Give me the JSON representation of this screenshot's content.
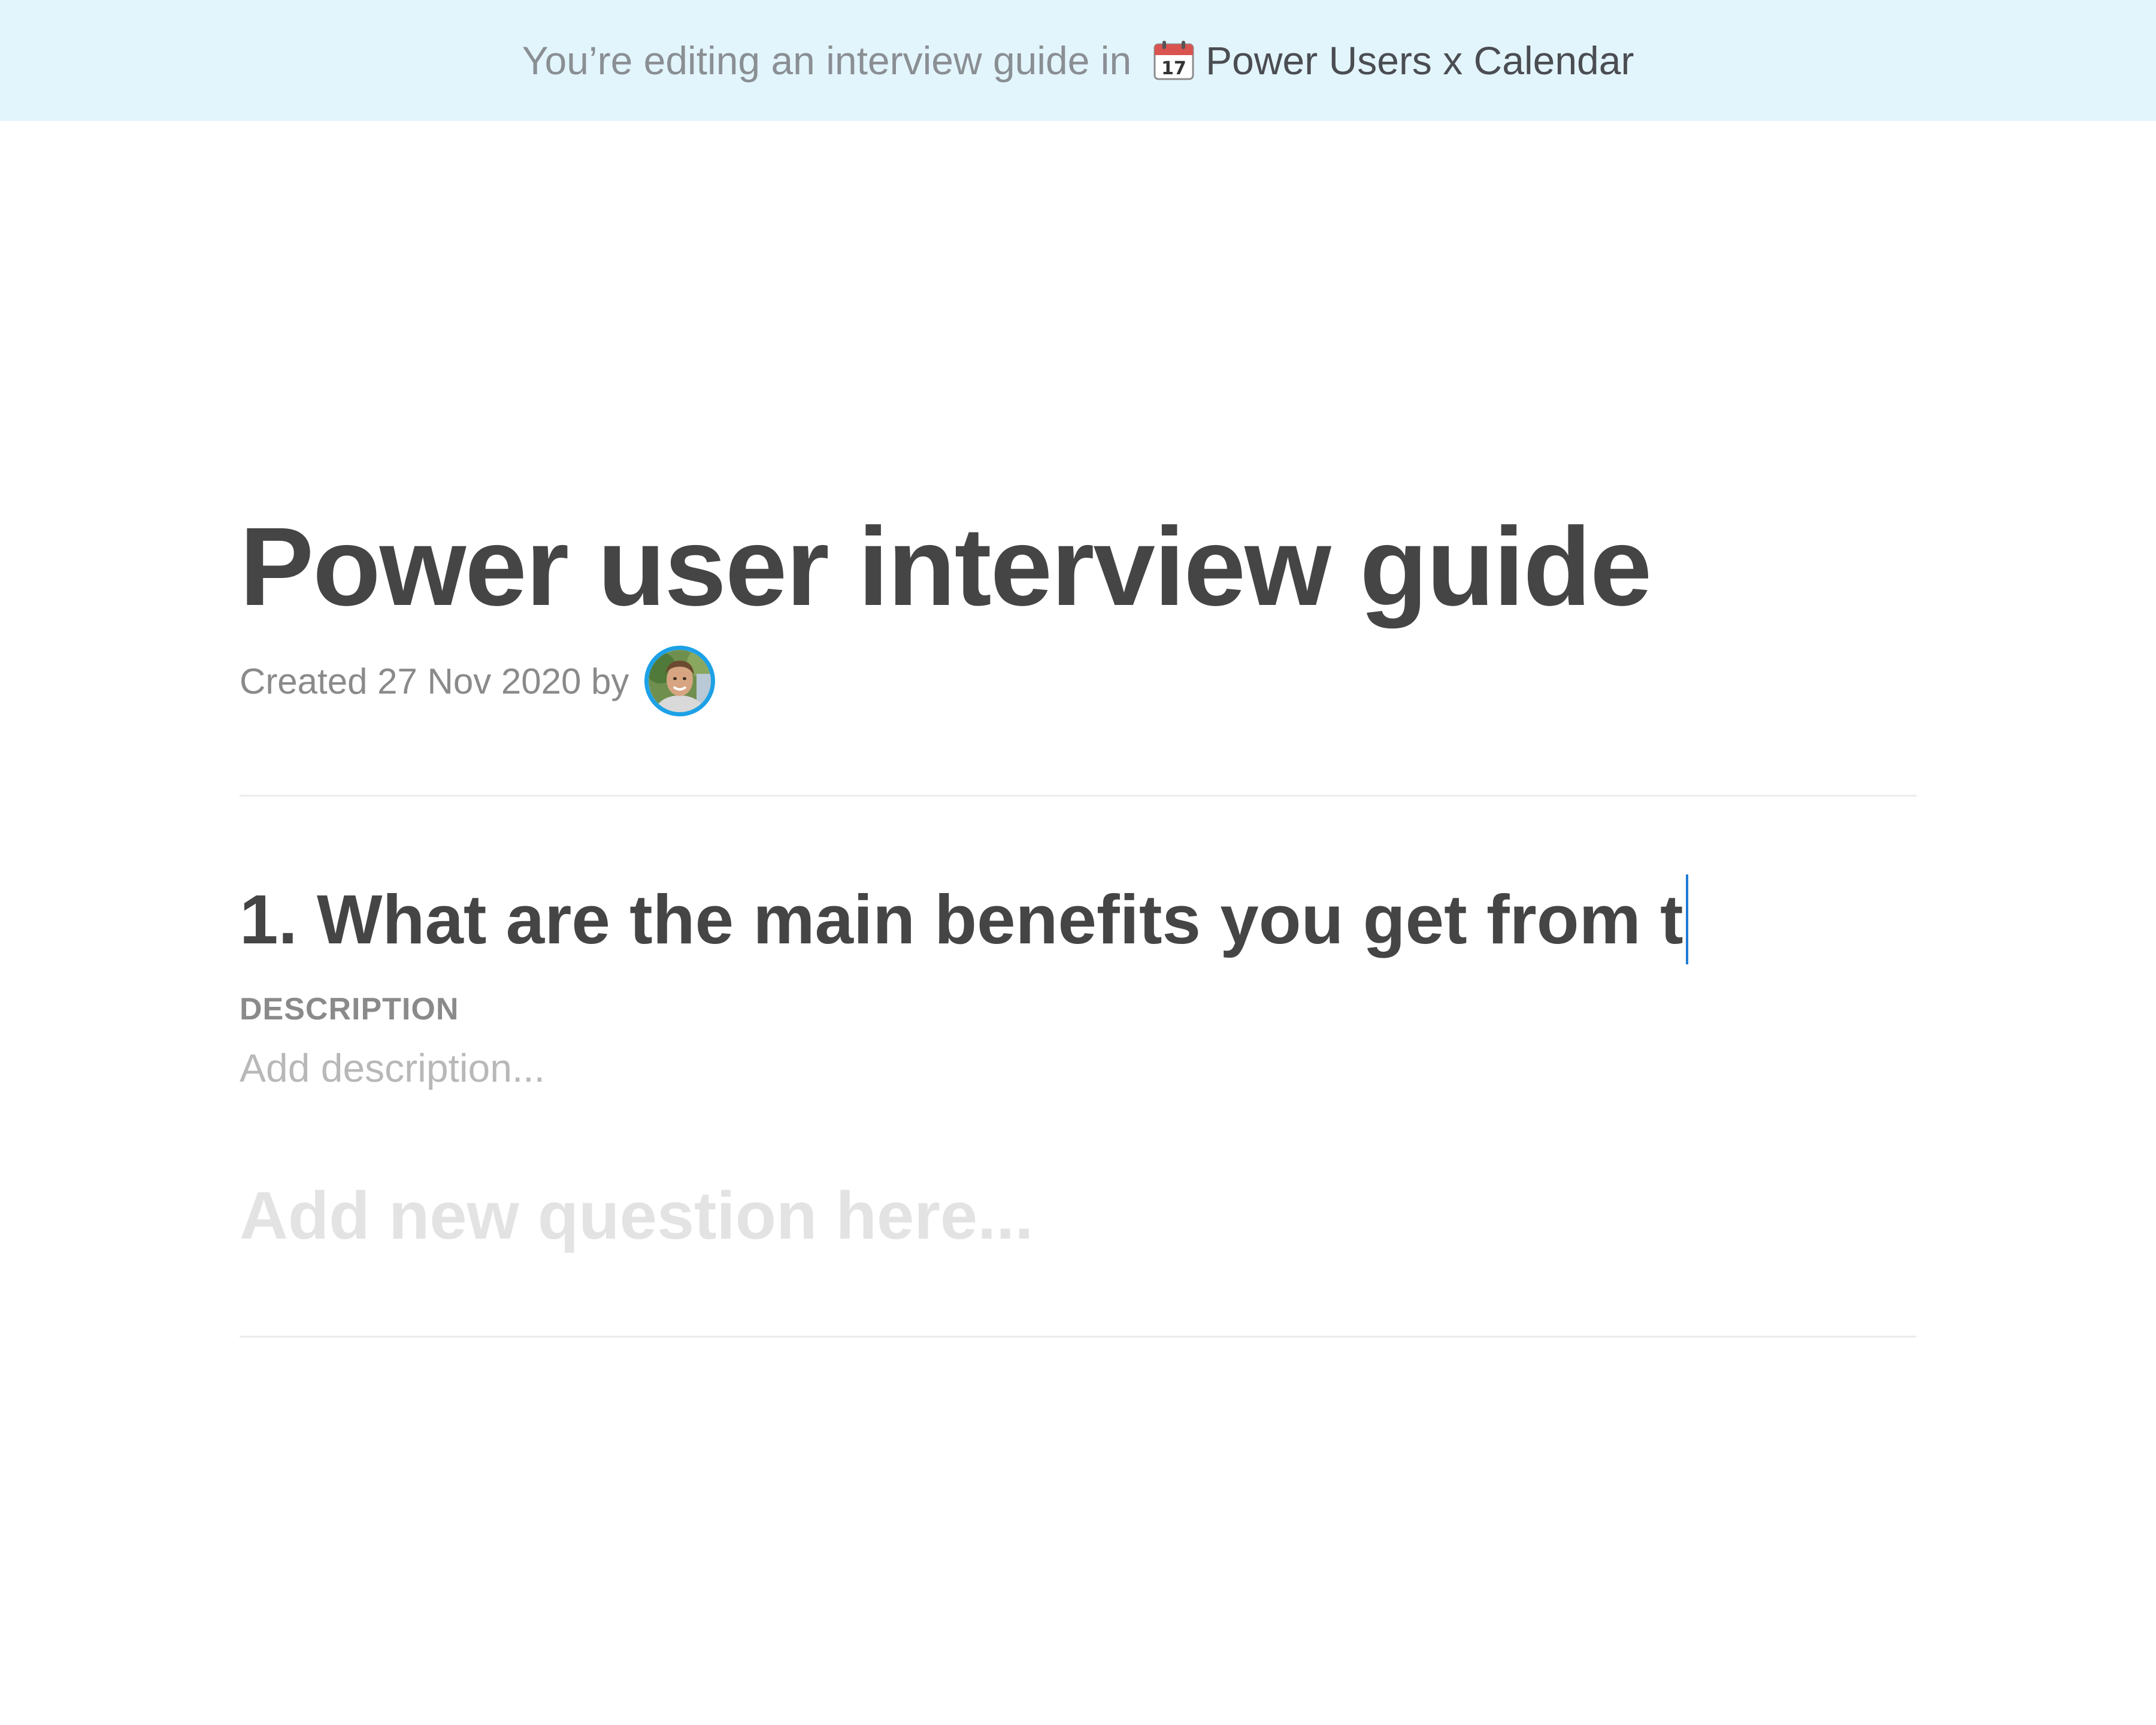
{
  "banner": {
    "prefix": "You’re editing an interview guide in",
    "project_icon": "calendar-icon",
    "project_name": "Power Users x Calendar"
  },
  "guide": {
    "title": "Power user interview guide",
    "created_text": "Created 27 Nov 2020 by",
    "author_avatar": "avatar"
  },
  "questions": [
    {
      "text": "1. What are the main benefits you get from t",
      "description_label": "DESCRIPTION",
      "description_placeholder": "Add description..."
    }
  ],
  "new_question_placeholder": "Add new question here...",
  "colors": {
    "banner_bg": "#e3f5fc",
    "avatar_ring": "#1da1e6",
    "caret": "#1e7bd6"
  }
}
